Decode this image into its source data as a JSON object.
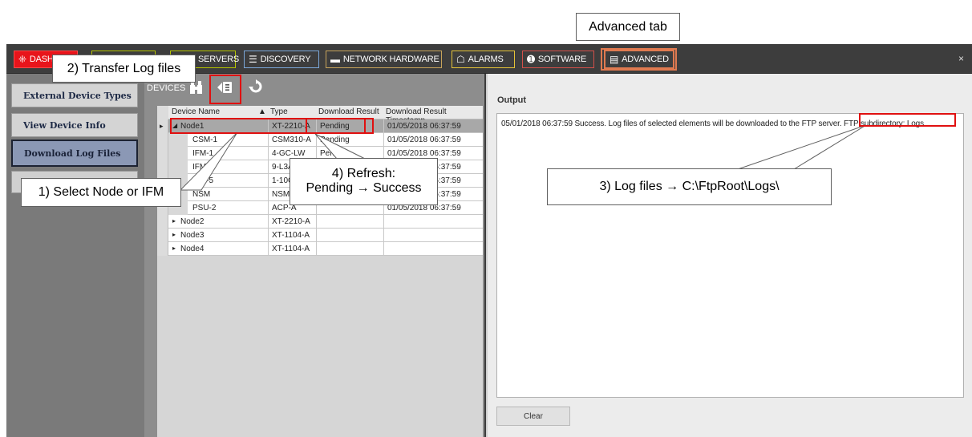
{
  "window": {
    "close_glyph": "×",
    "tabs": [
      {
        "label": "DASHBOARD",
        "icon": "dashboard-icon",
        "color": "#e8141b"
      },
      {
        "label": "SERVERS",
        "icon": "servers-icon",
        "color": "#b5c400"
      },
      {
        "label": "DISCOVERY",
        "icon": "discovery-icon",
        "color": "#7aa7d8"
      },
      {
        "label": "NETWORK HARDWARE",
        "icon": "network-hardware-icon",
        "color": "#c7a35a"
      },
      {
        "label": "ALARMS",
        "icon": "alarm-icon",
        "color": "#e5c338"
      },
      {
        "label": "SOFTWARE",
        "icon": "software-icon",
        "color": "#d4504a"
      },
      {
        "label": "ADVANCED",
        "icon": "advanced-icon",
        "color": "#e07a50"
      }
    ]
  },
  "left_menu": {
    "items": [
      {
        "label": "External Device Types",
        "active": false
      },
      {
        "label": "View Device Info",
        "active": false
      },
      {
        "label": "Download Log Files",
        "active": true
      }
    ]
  },
  "devices": {
    "label": "DEVICES",
    "columns": [
      "Device Name",
      "Type",
      "Download Result",
      "Download Result Timestamp"
    ],
    "rows": [
      {
        "name": "Node1",
        "type": "XT-2210-A",
        "result": "Pending",
        "timestamp": "01/05/2018 06:37:59",
        "level": 0,
        "expanded": true
      },
      {
        "name": "CSM-1",
        "type": "CSM310-A",
        "result": "Pending",
        "timestamp": "01/05/2018 06:37:59",
        "level": 1
      },
      {
        "name": "IFM-1",
        "type": "4-GC-LW",
        "result": "Pending",
        "timestamp": "01/05/2018 06:37:59",
        "level": 1
      },
      {
        "name": "IFM-3",
        "type": "9-L3A-",
        "result": "",
        "timestamp": "01/05/2018 06:37:59",
        "level": 1
      },
      {
        "name": "IFM-5",
        "type": "1-10G-",
        "result": "",
        "timestamp": "01/05/2018 06:37:59",
        "level": 1
      },
      {
        "name": "NSM",
        "type": "NSM-A",
        "result": "",
        "timestamp": "01/05/2018 06:37:59",
        "level": 1
      },
      {
        "name": "PSU-2",
        "type": "ACP-A",
        "result": "",
        "timestamp": "01/05/2018 06:37:59",
        "level": 1
      },
      {
        "name": "Node2",
        "type": "XT-2210-A",
        "result": "",
        "timestamp": "",
        "level": 0,
        "expanded": false
      },
      {
        "name": "Node3",
        "type": "XT-1104-A",
        "result": "",
        "timestamp": "",
        "level": 0,
        "expanded": false
      },
      {
        "name": "Node4",
        "type": "XT-1104-A",
        "result": "",
        "timestamp": "",
        "level": 0,
        "expanded": false
      }
    ]
  },
  "output": {
    "title": "Output",
    "log_line": "05/01/2018 06:37:59   Success. Log files of selected elements will be downloaded to the FTP server. FTP subdirectory: Logs",
    "clear_label": "Clear"
  },
  "annotations": {
    "advanced_tab": "Advanced tab",
    "transfer": "2) Transfer Log files",
    "select": "1) Select Node or IFM",
    "refresh_line1": "4) Refresh:",
    "refresh_line2": "Pending → Success",
    "logfiles": "3) Log files → C:\\FtpRoot\\Logs\\"
  }
}
